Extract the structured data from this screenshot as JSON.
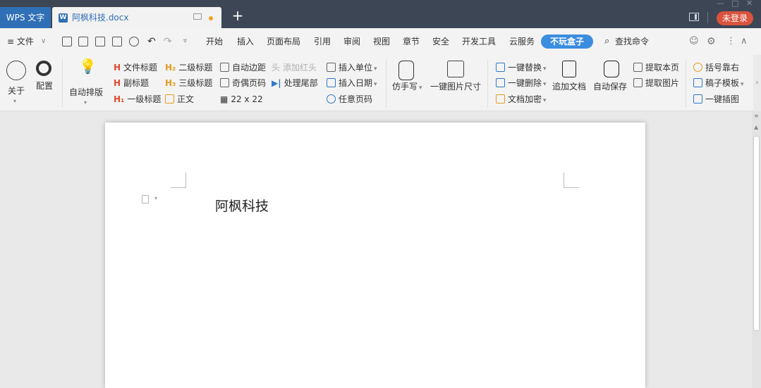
{
  "titlebar": {
    "app_name": "WPS 文字",
    "doc_tab": "阿枫科技.docx",
    "new_tab": "+",
    "login": "未登录"
  },
  "menubar": {
    "file": "≡ 文件",
    "tabs": [
      "开始",
      "插入",
      "页面布局",
      "引用",
      "审阅",
      "视图",
      "章节",
      "安全",
      "开发工具",
      "云服务"
    ],
    "active_tab": "不玩盒子",
    "search": "查找命令"
  },
  "ribbon": {
    "about": "关于",
    "config": "配置",
    "auto_layout": "自动排版",
    "doc_title": "文件标题",
    "subtitle": "副标题",
    "h1": "一级标题",
    "h2": "二级标题",
    "h3": "三级标题",
    "body_text": "正文",
    "auto_margin": "自动边距",
    "odd_even_page": "奇偶页码",
    "table_size": "22 x 22",
    "add_header": "添加红头",
    "handle_footer": "处理尾部",
    "insert_unit": "插入单位",
    "insert_date": "插入日期",
    "any_page_num": "任意页码",
    "imitate_handwriting": "仿手写",
    "one_click_img_size": "一键图片尺寸",
    "one_click_replace": "一键替换",
    "one_click_delete": "一键删除",
    "doc_encrypt": "文档加密",
    "append_doc": "追加文档",
    "auto_save": "自动保存",
    "extract_page": "提取本页",
    "extract_image": "提取图片",
    "bracket_right": "括号靠右",
    "manuscript_template": "稿子模板",
    "one_click_chart": "一键插图"
  },
  "document": {
    "text": "阿枫科技"
  }
}
